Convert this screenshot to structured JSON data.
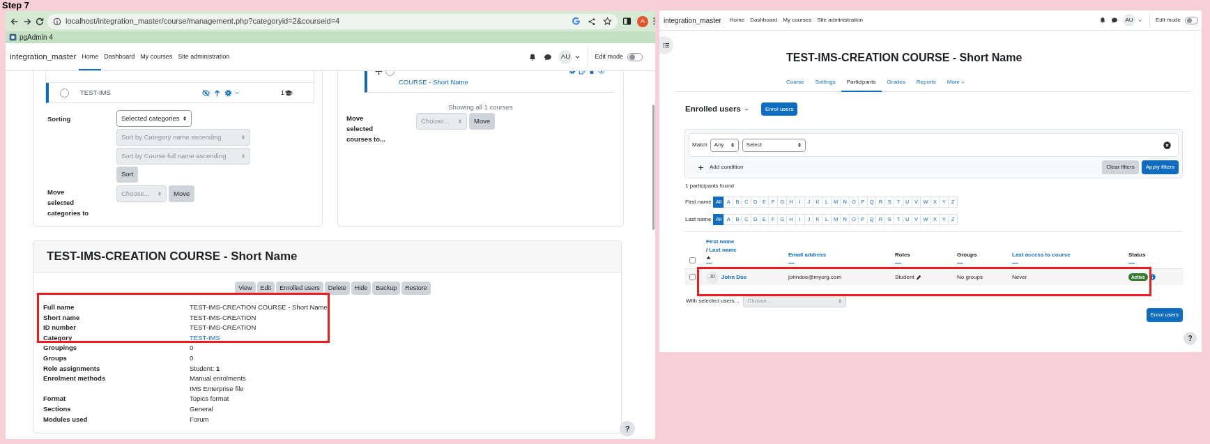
{
  "caption": "Step 7",
  "left_window": {
    "browser": {
      "url": "localhost/integration_master/course/management.php?categoryid=2&courseid=4",
      "profile_initial": "A",
      "bookmarks": [
        "pgAdmin 4"
      ]
    },
    "navbar": {
      "site_name": "integration_master",
      "links": [
        {
          "label": "Home",
          "selected": true
        },
        {
          "label": "Dashboard",
          "selected": false
        },
        {
          "label": "My courses",
          "selected": false
        },
        {
          "label": "Site administration",
          "selected": false
        }
      ],
      "avatar": "AU",
      "edit_mode": {
        "label": "Edit mode",
        "on": false
      }
    },
    "categories": {
      "rows": [
        {
          "name": "TEST-IMS",
          "count": "1",
          "visible": false,
          "checked": false,
          "selected": true
        }
      ],
      "sorting": {
        "label": "Sorting",
        "selects": [
          {
            "value": "Selected categories",
            "disabled": false
          },
          {
            "value": "Sort by Category name ascending",
            "disabled": true
          },
          {
            "value": "Sort by Course full name ascending",
            "disabled": true
          }
        ],
        "button": "Sort"
      },
      "move": {
        "label": "Move selected categories to",
        "select": {
          "value": "Choose...",
          "disabled": true
        },
        "button": "Move"
      }
    },
    "courses": {
      "rows": [
        {
          "name": "COURSE - Short Name",
          "checked": false,
          "selected": true
        }
      ],
      "summary": "Showing all 1 courses",
      "move": {
        "label": "Move selected courses to...",
        "select": {
          "value": "Choose...",
          "disabled": true
        },
        "button": "Move"
      }
    },
    "course_detail": {
      "title": "TEST-IMS-CREATION COURSE - Short Name",
      "buttons": [
        "View",
        "Edit",
        "Enrolled users",
        "Delete",
        "Hide",
        "Backup",
        "Restore"
      ],
      "fields": [
        {
          "label": "Full name",
          "values": [
            "TEST-IMS-CREATION COURSE - Short Name"
          ]
        },
        {
          "label": "Short name",
          "values": [
            "TEST-IMS-CREATION"
          ]
        },
        {
          "label": "ID number",
          "values": [
            "TEST-IMS-CREATION"
          ]
        },
        {
          "label": "Category",
          "values": [
            "TEST-IMS"
          ],
          "link": true
        },
        {
          "label": "Groupings",
          "values": [
            "0"
          ]
        },
        {
          "label": "Groups",
          "values": [
            "0"
          ]
        },
        {
          "label": "Role assignments",
          "values": [
            "Student: **1**"
          ]
        },
        {
          "label": "Enrolment methods",
          "values": [
            "Manual enrolments",
            "IMS Enterprise file"
          ]
        },
        {
          "label": "Format",
          "values": [
            "Topics format"
          ]
        },
        {
          "label": "Sections",
          "values": [
            "General"
          ]
        },
        {
          "label": "Modules used",
          "values": [
            "Forum"
          ]
        }
      ]
    },
    "help": "?"
  },
  "right_window": {
    "navbar": {
      "site_name": "integration_master",
      "links": [
        {
          "label": "Home",
          "selected": false
        },
        {
          "label": "Dashboard",
          "selected": false
        },
        {
          "label": "My courses",
          "selected": false
        },
        {
          "label": "Site administration",
          "selected": false
        }
      ],
      "avatar": "AU",
      "edit_mode": {
        "label": "Edit mode",
        "on": false
      }
    },
    "course_title": "TEST-IMS-CREATION COURSE - Short Name",
    "tabs": [
      {
        "label": "Course",
        "selected": false
      },
      {
        "label": "Settings",
        "selected": false
      },
      {
        "label": "Participants",
        "selected": true
      },
      {
        "label": "Grades",
        "selected": false
      },
      {
        "label": "Reports",
        "selected": false
      },
      {
        "label": "More",
        "selected": false,
        "menu": true
      }
    ],
    "heading": "Enrolled users",
    "enrol_button": "Enrol users",
    "filter": {
      "match_label": "Match",
      "match_value": "Any",
      "field_value": "Select",
      "add_condition": "Add condition",
      "buttons": [
        {
          "label": "Clear filters",
          "primary": false
        },
        {
          "label": "Apply filters",
          "primary": true
        }
      ]
    },
    "found": "1 participants found",
    "initials": [
      {
        "label": "First name",
        "letters": [
          {
            "label": "All",
            "selected": true
          },
          {
            "label": "A",
            "selected": false
          },
          {
            "label": "B",
            "selected": false
          },
          {
            "label": "C",
            "selected": false
          },
          {
            "label": "D",
            "selected": false
          },
          {
            "label": "E",
            "selected": false
          },
          {
            "label": "F",
            "selected": false
          },
          {
            "label": "G",
            "selected": false
          },
          {
            "label": "H",
            "selected": false
          },
          {
            "label": "I",
            "selected": false
          },
          {
            "label": "J",
            "selected": false
          },
          {
            "label": "K",
            "selected": false
          },
          {
            "label": "L",
            "selected": false
          },
          {
            "label": "M",
            "selected": false
          },
          {
            "label": "N",
            "selected": false
          },
          {
            "label": "O",
            "selected": false
          },
          {
            "label": "P",
            "selected": false
          },
          {
            "label": "Q",
            "selected": false
          },
          {
            "label": "R",
            "selected": false
          },
          {
            "label": "S",
            "selected": false
          },
          {
            "label": "T",
            "selected": false
          },
          {
            "label": "U",
            "selected": false
          },
          {
            "label": "V",
            "selected": false
          },
          {
            "label": "W",
            "selected": false
          },
          {
            "label": "X",
            "selected": false
          },
          {
            "label": "Y",
            "selected": false
          },
          {
            "label": "Z",
            "selected": false
          }
        ]
      },
      {
        "label": "Last name",
        "letters": [
          {
            "label": "All",
            "selected": true
          },
          {
            "label": "A",
            "selected": false
          },
          {
            "label": "B",
            "selected": false
          },
          {
            "label": "C",
            "selected": false
          },
          {
            "label": "D",
            "selected": false
          },
          {
            "label": "E",
            "selected": false
          },
          {
            "label": "F",
            "selected": false
          },
          {
            "label": "G",
            "selected": false
          },
          {
            "label": "H",
            "selected": false
          },
          {
            "label": "I",
            "selected": false
          },
          {
            "label": "J",
            "selected": false
          },
          {
            "label": "K",
            "selected": false
          },
          {
            "label": "L",
            "selected": false
          },
          {
            "label": "M",
            "selected": false
          },
          {
            "label": "N",
            "selected": false
          },
          {
            "label": "O",
            "selected": false
          },
          {
            "label": "P",
            "selected": false
          },
          {
            "label": "Q",
            "selected": false
          },
          {
            "label": "R",
            "selected": false
          },
          {
            "label": "S",
            "selected": false
          },
          {
            "label": "T",
            "selected": false
          },
          {
            "label": "U",
            "selected": false
          },
          {
            "label": "V",
            "selected": false
          },
          {
            "label": "W",
            "selected": false
          },
          {
            "label": "X",
            "selected": false
          },
          {
            "label": "Y",
            "selected": false
          },
          {
            "label": "Z",
            "selected": false
          }
        ]
      }
    ],
    "table": {
      "select_all_checked": false,
      "columns": [
        {
          "kind": "name",
          "first": "First name",
          "separator": "/",
          "last": "Last name"
        },
        {
          "kind": "link",
          "label": "Email address"
        },
        {
          "kind": "plain",
          "label": "Roles"
        },
        {
          "kind": "plain",
          "label": "Groups"
        },
        {
          "kind": "link",
          "label": "Last access to course"
        },
        {
          "kind": "plain",
          "label": "Status"
        }
      ],
      "rows": [
        {
          "checked": false,
          "initials": "JD",
          "name": "John Doe",
          "email": "johndoe@myorg.com",
          "role": "Student",
          "groups": "No groups",
          "last_access": "Never",
          "status": "Active"
        }
      ]
    },
    "bulk": {
      "label": "With selected users...",
      "select": {
        "value": "Choose...",
        "disabled": true
      }
    },
    "footer_button": "Enrol users",
    "help": "?"
  }
}
